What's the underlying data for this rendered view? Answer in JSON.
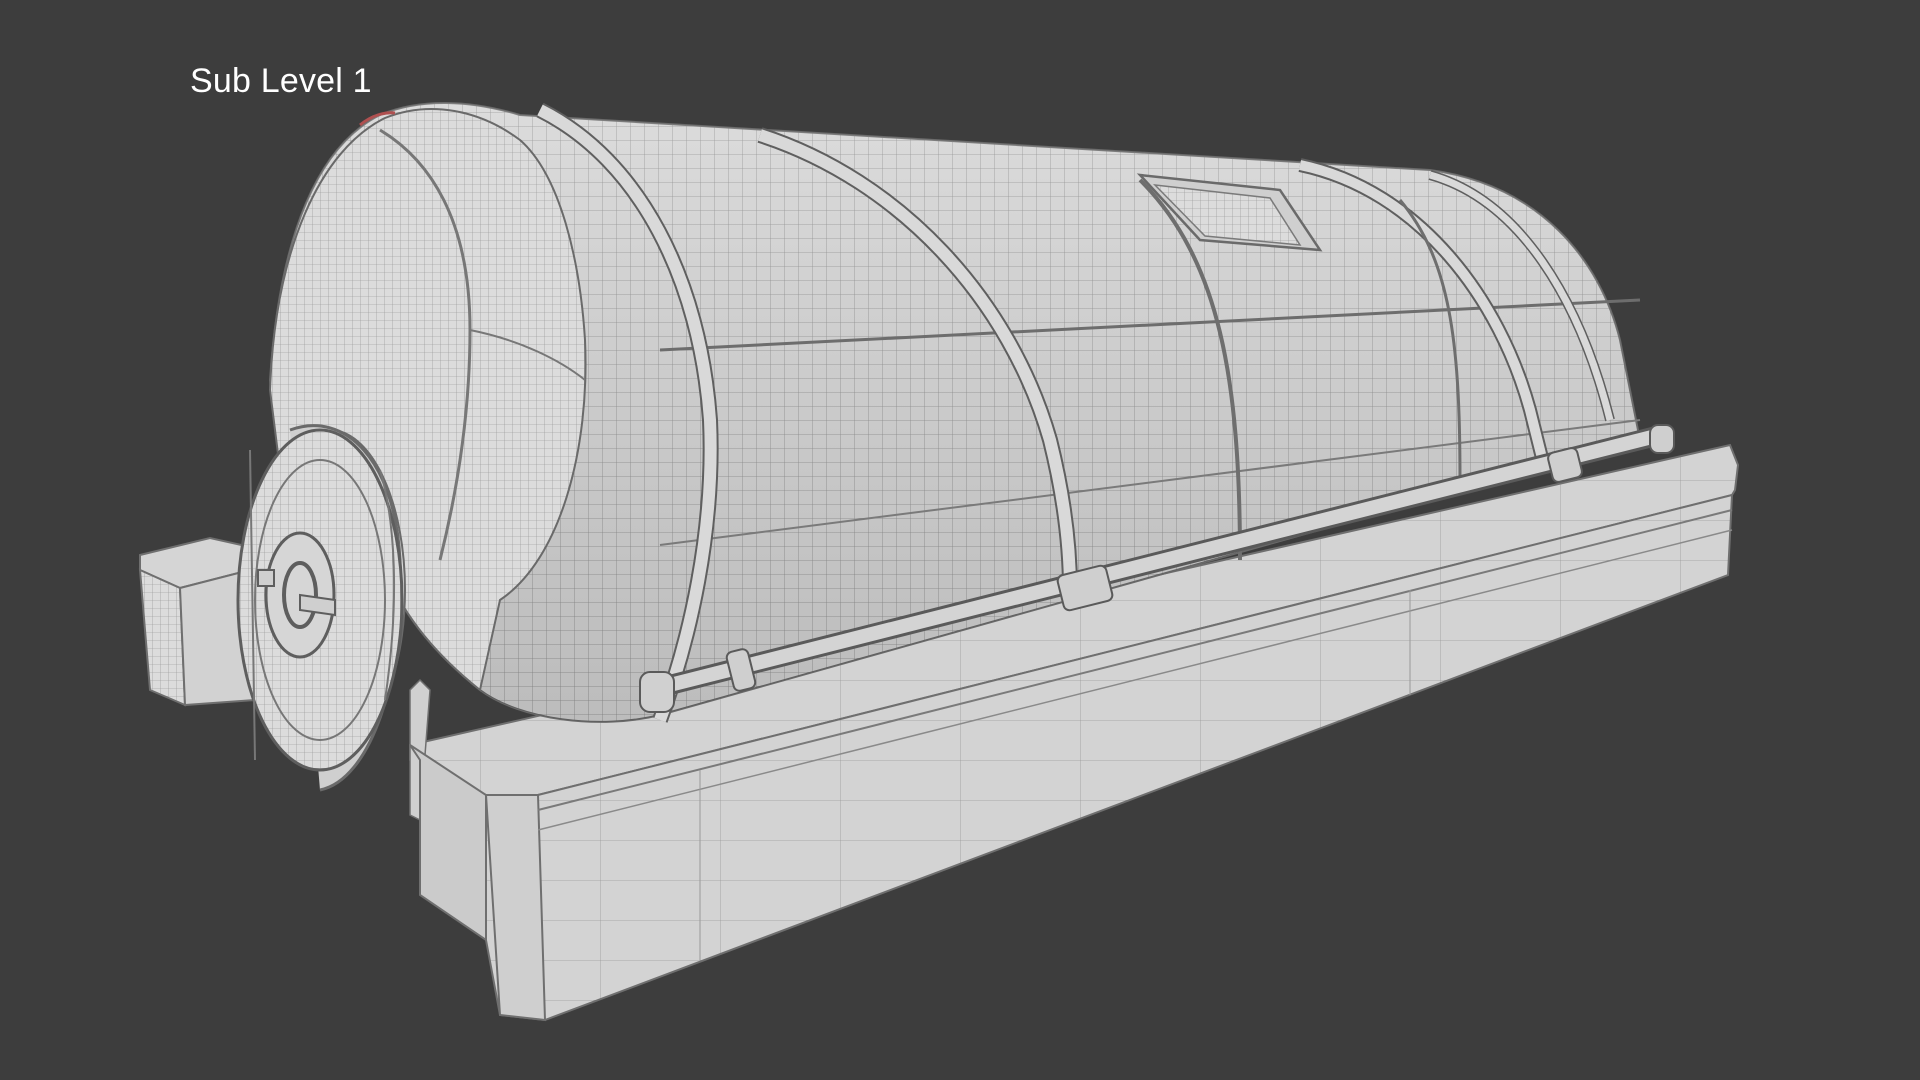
{
  "viewport": {
    "label": "Sub Level 1",
    "background": "#3d3d3d",
    "model": {
      "name": "capsule-pod",
      "display_mode": "wireframe-on-shaded",
      "shade_color": "#d9d9d9",
      "wire_color": "#7a7a7a"
    }
  }
}
